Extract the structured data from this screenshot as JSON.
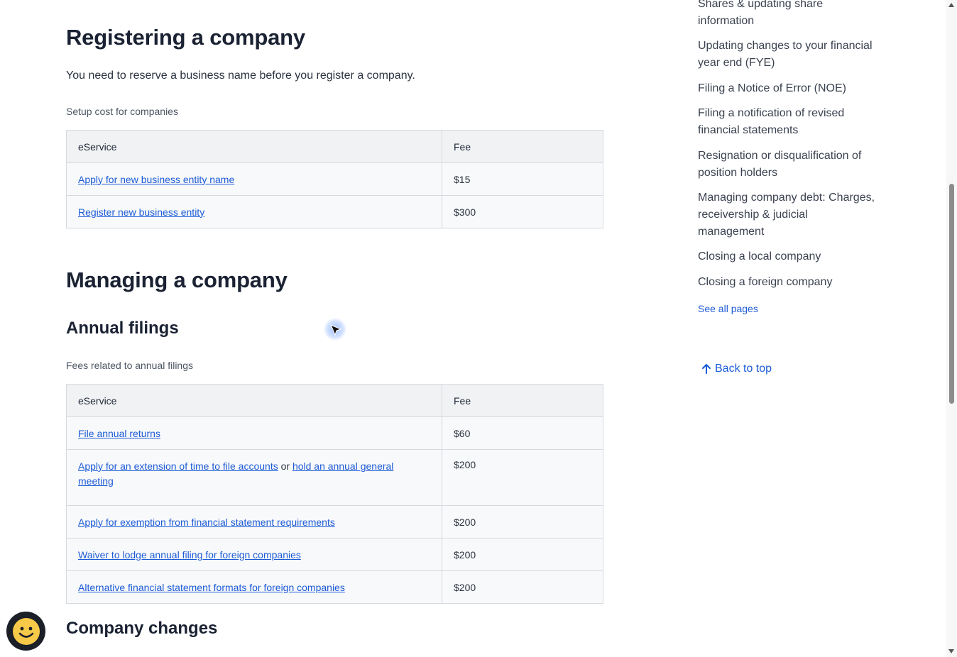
{
  "registering": {
    "title": "Registering a company",
    "intro": "You need to reserve a business name before you register a company.",
    "caption": "Setup cost for companies",
    "table": {
      "headers": [
        "eService",
        "Fee"
      ],
      "rows": [
        {
          "service": "Apply for new business entity name",
          "fee": "$15"
        },
        {
          "service": "Register new business entity",
          "fee": "$300"
        }
      ]
    }
  },
  "managing": {
    "title": "Managing a company",
    "annual": {
      "title": "Annual filings",
      "caption": "Fees related to annual filings",
      "table": {
        "headers": [
          "eService",
          "Fee"
        ],
        "rows": [
          {
            "service": "File annual returns",
            "fee": "$60"
          },
          {
            "service_a": "Apply for an extension of time to file accounts",
            "connector": "or",
            "service_b": "hold an annual general meeting",
            "fee": "$200"
          },
          {
            "service": "Apply for exemption from financial statement requirements",
            "fee": "$200"
          },
          {
            "service": "Waiver to lodge annual filing for foreign companies",
            "fee": "$200"
          },
          {
            "service": "Alternative financial statement formats for foreign companies",
            "fee": "$200"
          }
        ]
      }
    },
    "changes_title": "Company changes"
  },
  "sidebar": {
    "items": [
      "Shares & updating share information",
      "Updating changes to your financial year end (FYE)",
      "Filing a Notice of Error (NOE)",
      "Filing a notification of revised financial statements",
      "Resignation or disqualification of position holders",
      "Managing company debt: Charges, receivership & judicial management",
      "Closing a local company",
      "Closing a foreign company"
    ],
    "see_all": "See all pages",
    "back_to_top": "Back to top"
  },
  "colors": {
    "link": "#1c5bd6",
    "heading": "#1a2233",
    "table_header_bg": "#f1f2f4"
  },
  "icons": [
    "arrow-up-icon",
    "smiley-icon",
    "cursor-icon"
  ]
}
